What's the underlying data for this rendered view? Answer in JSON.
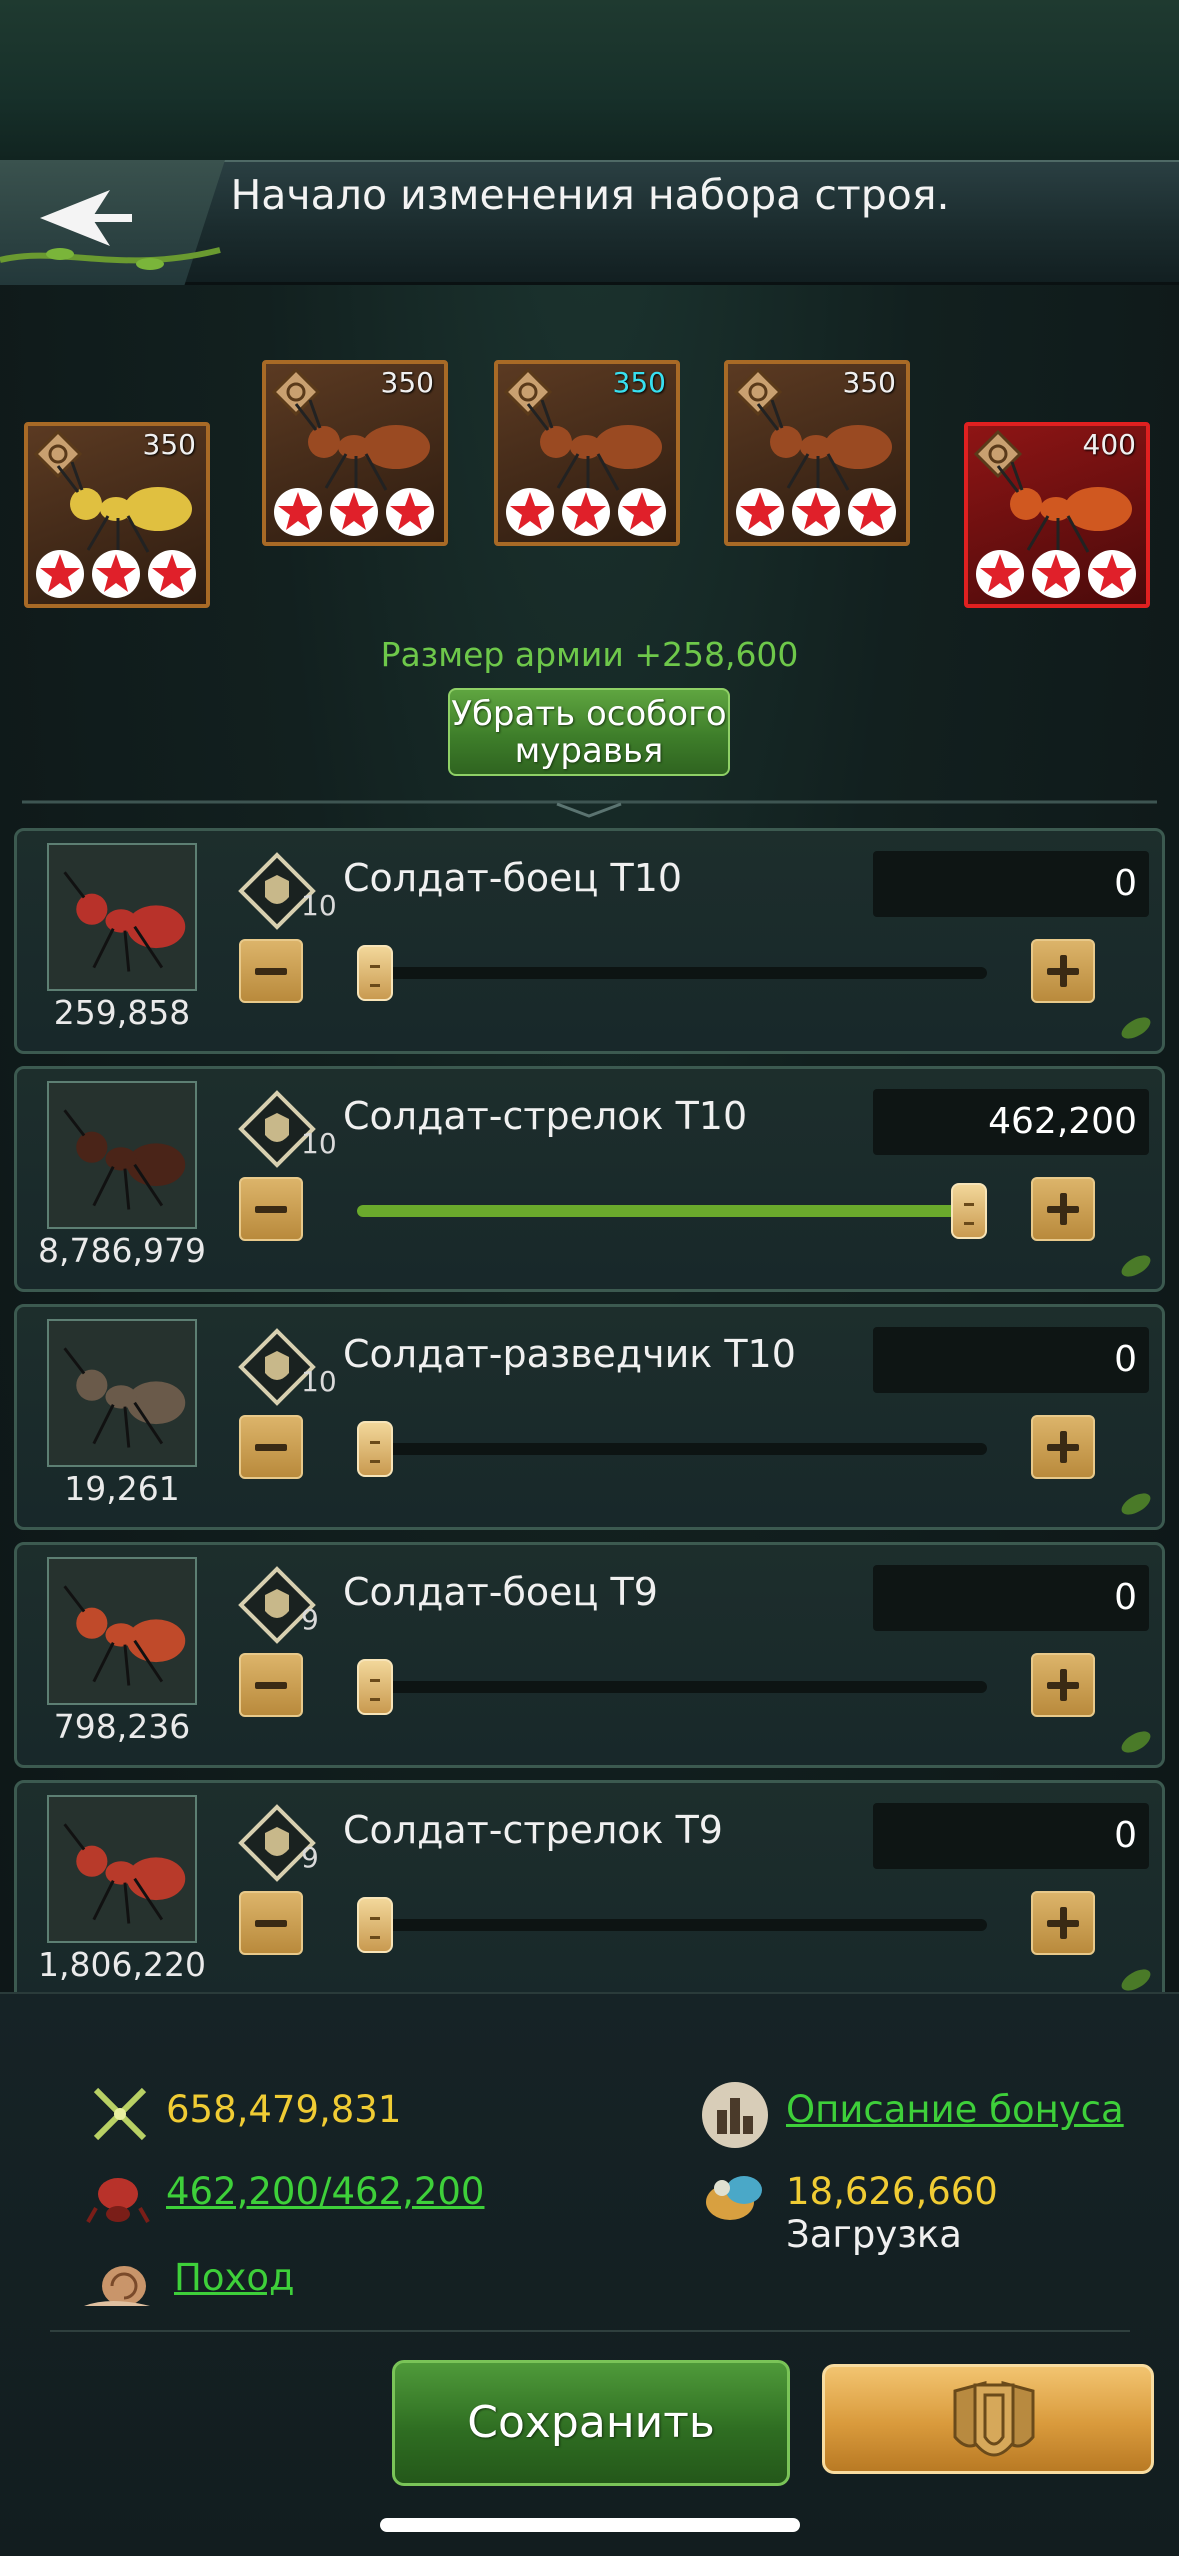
{
  "header": {
    "title": "Начало изменения набора строя."
  },
  "heroes": [
    {
      "level": "350",
      "level_color": "white",
      "stars": 3,
      "type": "white"
    },
    {
      "level": "350",
      "level_color": "white",
      "stars": 3,
      "type": "brown"
    },
    {
      "level": "350",
      "level_color": "cyan",
      "stars": 3,
      "type": "brown"
    },
    {
      "level": "350",
      "level_color": "white",
      "stars": 3,
      "type": "brown"
    },
    {
      "level": "400",
      "level_color": "white",
      "stars": 3,
      "type": "red"
    }
  ],
  "army": {
    "size_text": "Размер армии +258,600",
    "remove_special_label": "Убрать особого муравья"
  },
  "troops": [
    {
      "name": "Солдат-боец T10",
      "tier": "10",
      "count": "259,858",
      "value": "0",
      "slider_fraction": 0
    },
    {
      "name": "Солдат-стрелок T10",
      "tier": "10",
      "count": "8,786,979",
      "value": "462,200",
      "slider_fraction": 1
    },
    {
      "name": "Солдат-разведчик T10",
      "tier": "10",
      "count": "19,261",
      "value": "0",
      "slider_fraction": 0
    },
    {
      "name": "Солдат-боец T9",
      "tier": "9",
      "count": "798,236",
      "value": "0",
      "slider_fraction": 0
    },
    {
      "name": "Солдат-стрелок T9",
      "tier": "9",
      "count": "1,806,220",
      "value": "0",
      "slider_fraction": 0
    }
  ],
  "stats": {
    "power": "658,479,831",
    "troops": "462,200/462,200",
    "march_link": "Поход",
    "bonus_link": "Описание бонуса",
    "load_value": "18,626,660",
    "load_label": "Загрузка"
  },
  "actions": {
    "save_label": "Сохранить"
  },
  "colors": {
    "accent_green": "#6ec84a",
    "link_green": "#3ed03a",
    "stat_yellow": "#f0cc34",
    "gold_button": "#d99a3c"
  }
}
